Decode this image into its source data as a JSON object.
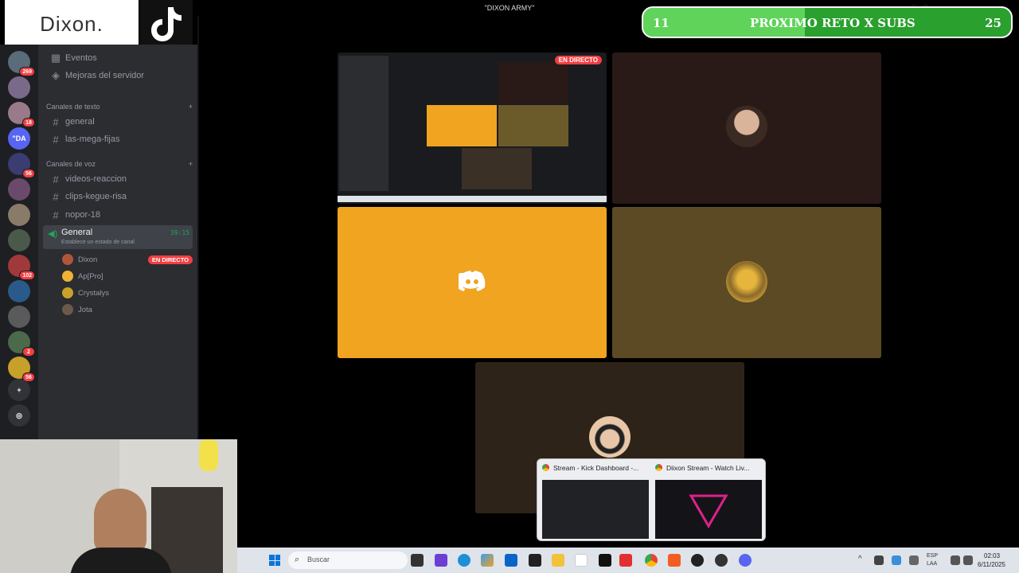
{
  "overlay": {
    "logo_text": "Dixon.",
    "window_title": "\"DIXON ARMY\"",
    "subs_goal": {
      "current": "11",
      "label": "PROXIMO RETO X SUBS",
      "target": "25",
      "progress_fraction": 0.44
    }
  },
  "servers": [
    {
      "badge": "269"
    },
    {
      "badge": ""
    },
    {
      "badge": "18"
    },
    {
      "label": "\"DA",
      "badge": ""
    },
    {
      "badge": "56"
    },
    {
      "badge": ""
    },
    {
      "badge": ""
    },
    {
      "badge": ""
    },
    {
      "badge": "102"
    },
    {
      "badge": ""
    },
    {
      "badge": ""
    },
    {
      "badge": "2"
    },
    {
      "badge": "56"
    }
  ],
  "sidebar": {
    "events": "Eventos",
    "boosts": "Mejoras del servidor",
    "text_category": "Canales de texto",
    "text_channels": [
      "general",
      "las-mega-fijas"
    ],
    "voice_category": "Canales de voz",
    "voice_channels": [
      "videos-reaccion",
      "clips-kegue-risa",
      "nopor-18"
    ],
    "active_voice": {
      "name": "General",
      "time": "39:15",
      "status": "Establece un estado de canal"
    },
    "members": [
      {
        "name": "Dixon",
        "live": "EN DIRECTO",
        "color": "#b0553a"
      },
      {
        "name": "Ap[Pro]",
        "live": "",
        "color": "#f0b232"
      },
      {
        "name": "Crystalys",
        "live": "",
        "color": "#c9a227"
      },
      {
        "name": "Jota",
        "live": "",
        "color": "#6b5a4a"
      }
    ]
  },
  "stage": {
    "stream_live": "EN DIRECTO",
    "colors": {
      "tile1": "#2a1a17",
      "tile_yellow": "#f0a41f",
      "tile_olive": "#5b4a24",
      "tile_brown": "#2d2318"
    }
  },
  "taskbar": {
    "search_placeholder": "Buscar",
    "lang": "ESP",
    "lang2": "LAA",
    "time": "02:03",
    "date": "6/11/2025",
    "previews": [
      {
        "title": "Stream - Kick Dashboard -..."
      },
      {
        "title": "Diixon Stream - Watch Liv..."
      }
    ]
  }
}
